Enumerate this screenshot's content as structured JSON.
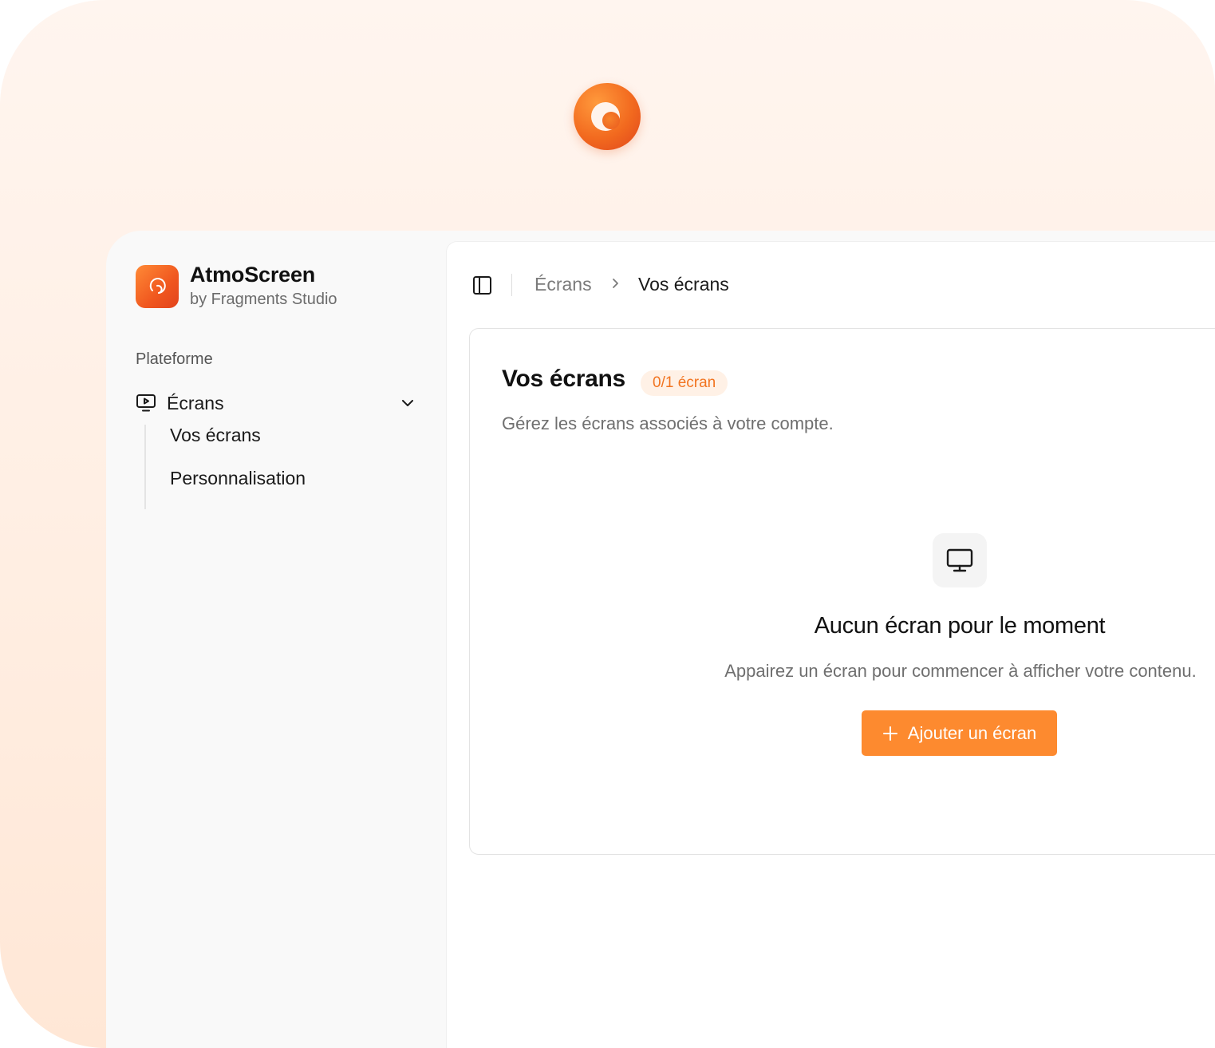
{
  "brand": {
    "name": "AtmoScreen",
    "subtitle": "by Fragments Studio",
    "accent_color": "#f26a1f"
  },
  "sidebar": {
    "section_label": "Plateforme",
    "group": {
      "label": "Écrans",
      "icon": "screen-play-icon",
      "expanded": true
    },
    "items": [
      {
        "label": "Vos écrans"
      },
      {
        "label": "Personnalisation"
      }
    ]
  },
  "topbar": {
    "breadcrumb": [
      {
        "label": "Écrans"
      },
      {
        "label": "Vos écrans"
      }
    ]
  },
  "card": {
    "title": "Vos écrans",
    "badge": "0/1 écran",
    "description": "Gérez les écrans associés à votre compte."
  },
  "empty_state": {
    "icon": "monitor-icon",
    "title": "Aucun écran pour le moment",
    "description": "Appairez un écran pour commencer à afficher votre contenu.",
    "button_label": "Ajouter un écran",
    "button_color": "#fd8a2f"
  }
}
